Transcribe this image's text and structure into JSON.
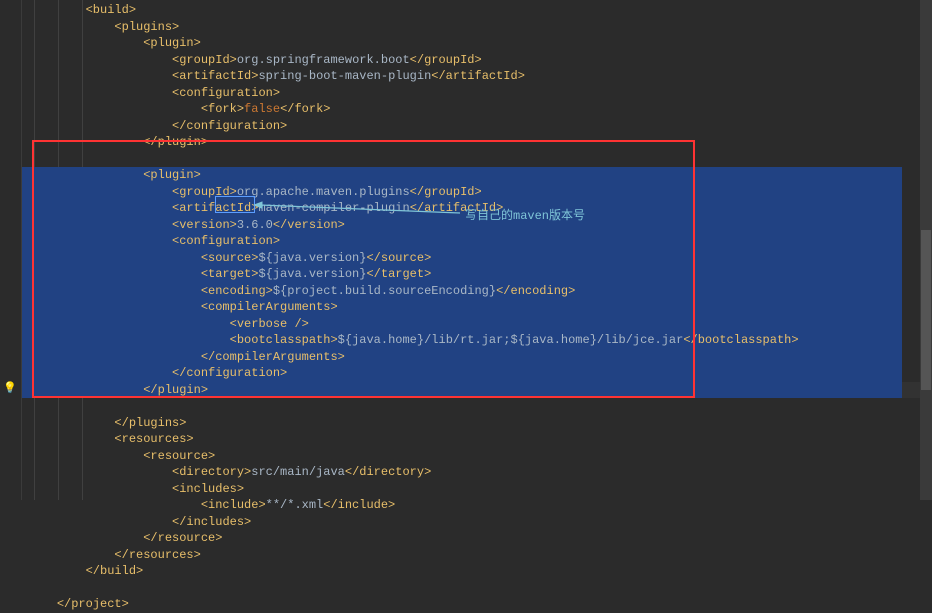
{
  "colors": {
    "tag": "#e8bf6a",
    "text": "#a9b7c6",
    "keyword": "#cc7832",
    "selection": "#214283",
    "background": "#2b2b2b",
    "annotation": "#7fc5d8",
    "border": "#ff3333"
  },
  "annotation": "写自己的maven版本号",
  "lines": [
    {
      "indent": 2,
      "tokens": [
        {
          "k": "t",
          "v": "<build>"
        }
      ]
    },
    {
      "indent": 3,
      "tokens": [
        {
          "k": "t",
          "v": "<plugins>"
        }
      ]
    },
    {
      "indent": 4,
      "tokens": [
        {
          "k": "t",
          "v": "<plugin>"
        }
      ]
    },
    {
      "indent": 5,
      "tokens": [
        {
          "k": "t",
          "v": "<groupId>"
        },
        {
          "k": "x",
          "v": "org.springframework.boot"
        },
        {
          "k": "t",
          "v": "</groupId>"
        }
      ]
    },
    {
      "indent": 5,
      "tokens": [
        {
          "k": "t",
          "v": "<artifactId>"
        },
        {
          "k": "x",
          "v": "spring-boot-maven-plugin"
        },
        {
          "k": "t",
          "v": "</artifactId>"
        }
      ]
    },
    {
      "indent": 5,
      "tokens": [
        {
          "k": "t",
          "v": "<configuration>"
        }
      ]
    },
    {
      "indent": 6,
      "tokens": [
        {
          "k": "t",
          "v": "<fork>"
        },
        {
          "k": "k",
          "v": "false"
        },
        {
          "k": "t",
          "v": "</fork>"
        }
      ]
    },
    {
      "indent": 5,
      "tokens": [
        {
          "k": "t",
          "v": "</configuration>"
        }
      ]
    },
    {
      "indent": 4,
      "tokens": [
        {
          "k": "t",
          "v": "</plugin>"
        }
      ]
    },
    {
      "indent": 0,
      "tokens": []
    },
    {
      "indent": 4,
      "tokens": [
        {
          "k": "t",
          "v": "<plugin>"
        }
      ],
      "selected": true
    },
    {
      "indent": 5,
      "tokens": [
        {
          "k": "t",
          "v": "<groupId>"
        },
        {
          "k": "x",
          "v": "org.apache.maven.plugins"
        },
        {
          "k": "t",
          "v": "</groupId>"
        }
      ],
      "selected": true
    },
    {
      "indent": 5,
      "tokens": [
        {
          "k": "t",
          "v": "<artifactId>"
        },
        {
          "k": "x",
          "v": "maven-compiler-plugin"
        },
        {
          "k": "t",
          "v": "</artifactId>"
        }
      ],
      "selected": true
    },
    {
      "indent": 5,
      "tokens": [
        {
          "k": "t",
          "v": "<version>"
        },
        {
          "k": "x",
          "v": "3.6.0"
        },
        {
          "k": "t",
          "v": "</version>"
        }
      ],
      "selected": true
    },
    {
      "indent": 5,
      "tokens": [
        {
          "k": "t",
          "v": "<configuration>"
        }
      ],
      "selected": true
    },
    {
      "indent": 6,
      "tokens": [
        {
          "k": "t",
          "v": "<source>"
        },
        {
          "k": "x",
          "v": "${java.version}"
        },
        {
          "k": "t",
          "v": "</source>"
        }
      ],
      "selected": true
    },
    {
      "indent": 6,
      "tokens": [
        {
          "k": "t",
          "v": "<target>"
        },
        {
          "k": "x",
          "v": "${java.version}"
        },
        {
          "k": "t",
          "v": "</target>"
        }
      ],
      "selected": true
    },
    {
      "indent": 6,
      "tokens": [
        {
          "k": "t",
          "v": "<encoding>"
        },
        {
          "k": "x",
          "v": "${project.build.sourceEncoding}"
        },
        {
          "k": "t",
          "v": "</encoding>"
        }
      ],
      "selected": true
    },
    {
      "indent": 6,
      "tokens": [
        {
          "k": "t",
          "v": "<compilerArguments>"
        }
      ],
      "selected": true
    },
    {
      "indent": 7,
      "tokens": [
        {
          "k": "t",
          "v": "<verbose />"
        }
      ],
      "selected": true
    },
    {
      "indent": 7,
      "tokens": [
        {
          "k": "t",
          "v": "<bootclasspath>"
        },
        {
          "k": "x",
          "v": "${java.home}/lib/rt.jar;${java.home}/lib/jce.jar"
        },
        {
          "k": "t",
          "v": "</bootclasspath>"
        }
      ],
      "selected": true
    },
    {
      "indent": 6,
      "tokens": [
        {
          "k": "t",
          "v": "</compilerArguments>"
        }
      ],
      "selected": true
    },
    {
      "indent": 5,
      "tokens": [
        {
          "k": "t",
          "v": "</configuration>"
        }
      ],
      "selected": true
    },
    {
      "indent": 4,
      "tokens": [
        {
          "k": "t",
          "v": "</plugin>"
        }
      ],
      "selected": true,
      "caret": true
    },
    {
      "indent": 0,
      "tokens": []
    },
    {
      "indent": 3,
      "tokens": [
        {
          "k": "t",
          "v": "</plugins>"
        }
      ]
    },
    {
      "indent": 3,
      "tokens": [
        {
          "k": "t",
          "v": "<resources>"
        }
      ]
    },
    {
      "indent": 4,
      "tokens": [
        {
          "k": "t",
          "v": "<resource>"
        }
      ]
    },
    {
      "indent": 5,
      "tokens": [
        {
          "k": "t",
          "v": "<directory>"
        },
        {
          "k": "x",
          "v": "src/main/java"
        },
        {
          "k": "t",
          "v": "</directory>"
        }
      ]
    },
    {
      "indent": 5,
      "tokens": [
        {
          "k": "t",
          "v": "<includes>"
        }
      ]
    },
    {
      "indent": 6,
      "tokens": [
        {
          "k": "t",
          "v": "<include>"
        },
        {
          "k": "x",
          "v": "**/*.xml"
        },
        {
          "k": "t",
          "v": "</include>"
        }
      ]
    },
    {
      "indent": 5,
      "tokens": [
        {
          "k": "t",
          "v": "</includes>"
        }
      ]
    },
    {
      "indent": 4,
      "tokens": [
        {
          "k": "t",
          "v": "</resource>"
        }
      ]
    },
    {
      "indent": 3,
      "tokens": [
        {
          "k": "t",
          "v": "</resources>"
        }
      ]
    },
    {
      "indent": 2,
      "tokens": [
        {
          "k": "t",
          "v": "</build>"
        }
      ]
    },
    {
      "indent": 0,
      "tokens": []
    },
    {
      "indent": 1,
      "tokens": [
        {
          "k": "t",
          "v": "</project>"
        }
      ]
    }
  ]
}
